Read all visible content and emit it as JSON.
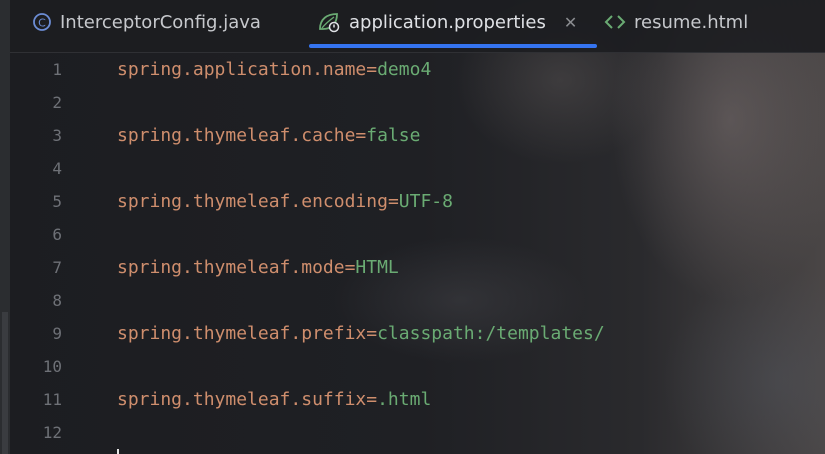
{
  "tabs": [
    {
      "label": "InterceptorConfig.java",
      "icon": "java-class-icon"
    },
    {
      "label": "application.properties",
      "icon": "spring-leaf-icon",
      "active": true,
      "close": "✕"
    },
    {
      "label": "resume.html",
      "icon": "html-icon"
    }
  ],
  "lines": [
    {
      "n": "1",
      "key": "spring.application.name",
      "eq": "=",
      "val": "demo4"
    },
    {
      "n": "2"
    },
    {
      "n": "3",
      "key": "spring.thymeleaf.cache",
      "eq": "=",
      "val": "false"
    },
    {
      "n": "4"
    },
    {
      "n": "5",
      "key": "spring.thymeleaf.encoding",
      "eq": "=",
      "val": "UTF-8"
    },
    {
      "n": "6"
    },
    {
      "n": "7",
      "key": "spring.thymeleaf.mode",
      "eq": "=",
      "val": "HTML"
    },
    {
      "n": "8"
    },
    {
      "n": "9",
      "key": "spring.thymeleaf.prefix",
      "eq": "=",
      "val": "classpath:/templates/"
    },
    {
      "n": "10"
    },
    {
      "n": "11",
      "key": "spring.thymeleaf.suffix",
      "eq": "=",
      "val": ".html"
    },
    {
      "n": "12"
    }
  ],
  "colors": {
    "key": "#cf8e6d",
    "value": "#6aab73",
    "line_number": "#6e7177",
    "accent": "#3574f0"
  }
}
